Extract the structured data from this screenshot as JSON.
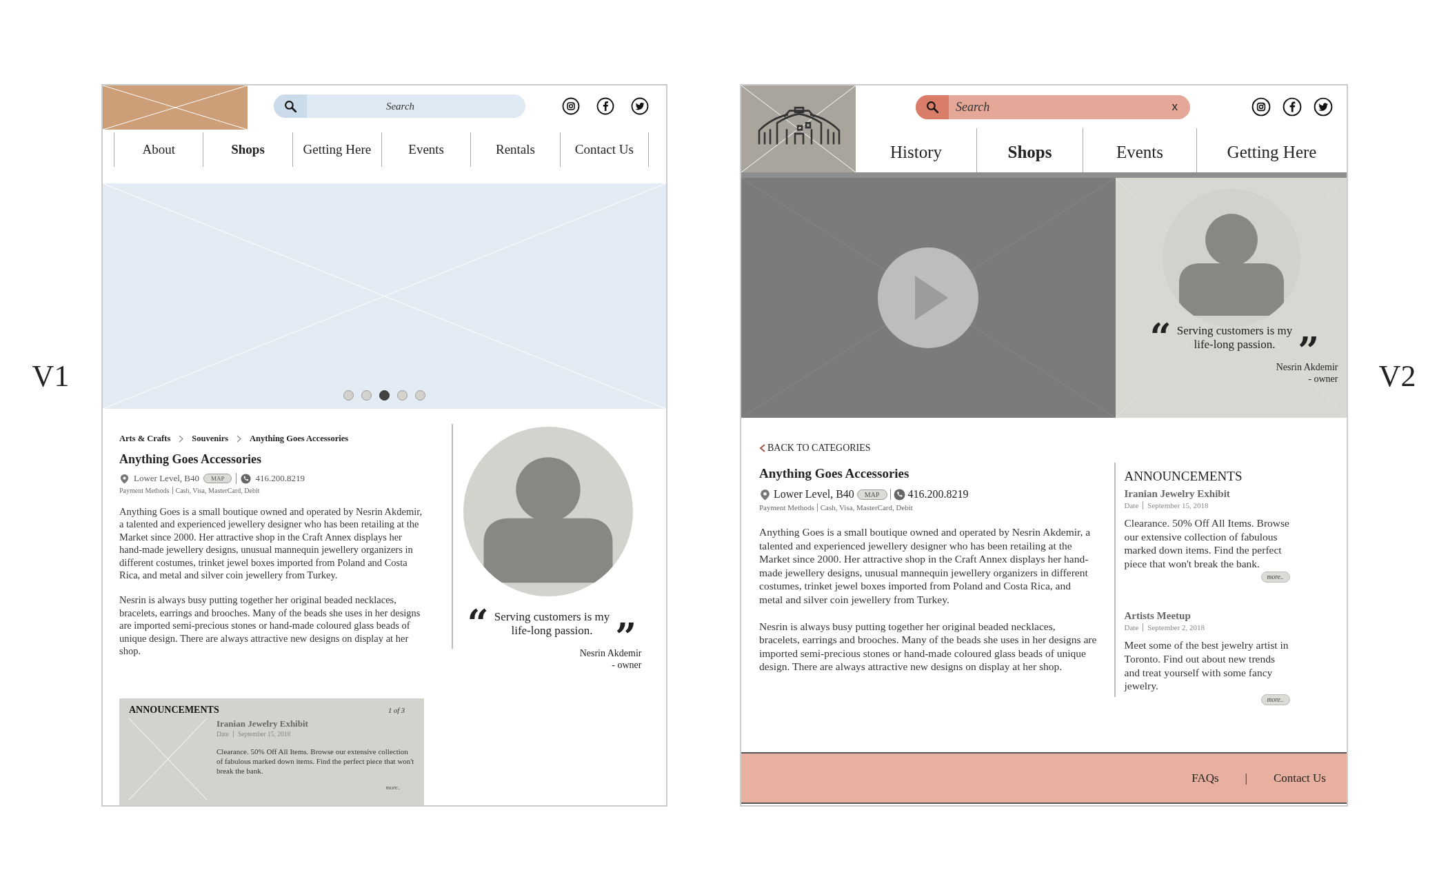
{
  "v1": {
    "label": "V1",
    "search": {
      "placeholder": "Search"
    },
    "nav": [
      {
        "label": "About",
        "selected": false
      },
      {
        "label": "Shops",
        "selected": true
      },
      {
        "label": "Getting Here",
        "selected": false
      },
      {
        "label": "Events",
        "selected": false
      },
      {
        "label": "Rentals",
        "selected": false
      },
      {
        "label": "Contact Us",
        "selected": false
      }
    ],
    "carousel": [
      {
        "selected": false
      },
      {
        "selected": false
      },
      {
        "selected": true
      },
      {
        "selected": false
      },
      {
        "selected": false
      }
    ],
    "breadcrumb": [
      "Arts & Crafts",
      "Souvenirs",
      "Anything Goes Accessories"
    ],
    "shop": {
      "name": "Anything Goes Accessories",
      "location": "Lower Level, B40",
      "map": "MAP",
      "phone": "416.200.8219",
      "payment_label": "Payment Methods",
      "payment": "Cash, Visa, MasterCard, Debit",
      "paragraphs": [
        "Anything Goes is a small boutique owned and operated by Nesrin Akdemir, a talented and experienced jewellery designer who has been retailing at the Market since 2000. Her attractive shop in the Craft Annex displays her hand-made jewellery designs, unusual mannequin jewellery organizers in different costumes, trinket jewel boxes imported from Poland and Costa Rica, and metal and silver coin jewellery from Turkey.",
        "Nesrin is always busy putting together her original beaded necklaces, bracelets, earrings and brooches. Many of the beads she uses in her designs are imported semi-precious stones or hand-made coloured glass beads of unique design. There are always attractive new designs on display at her shop."
      ]
    },
    "quote": {
      "open": "“",
      "lines": [
        "Serving customers is my",
        "life-long passion."
      ],
      "close": "”",
      "name": "Nesrin Akdemir",
      "role": "- owner"
    },
    "announcements": {
      "title": "ANNOUNCEMENTS",
      "pager": "1 of 3",
      "items": [
        {
          "title": "Iranian Jewelry Exhibit",
          "date_label": "Date",
          "date": "September 15, 2018",
          "text": "Clearance. 50% Off All Items. Browse our extensive collection of fabulous marked down items. Find the perfect piece that won't break the bank.",
          "more": "more.."
        }
      ]
    }
  },
  "v2": {
    "label": "V2",
    "search": {
      "placeholder": "Search",
      "clear": "x"
    },
    "nav": [
      {
        "label": "History",
        "selected": false
      },
      {
        "label": "Shops",
        "selected": true
      },
      {
        "label": "Events",
        "selected": false
      },
      {
        "label": "Getting Here",
        "selected": false
      }
    ],
    "quote": {
      "open": "“",
      "lines": [
        "Serving customers is my",
        "life-long passion."
      ],
      "close": "”",
      "name": "Nesrin Akdemir",
      "role": "- owner"
    },
    "back": "BACK TO CATEGORIES",
    "shop": {
      "name": "Anything Goes Accessories",
      "location": "Lower Level, B40",
      "map": "MAP",
      "phone": "416.200.8219",
      "payment_label": "Payment Methods",
      "payment": "Cash, Visa, MasterCard, Debit",
      "paragraphs": [
        "Anything Goes is a small boutique owned and operated by Nesrin Akdemir, a talented and experienced jewellery designer who has been retailing at the Market since 2000. Her attractive shop in the Craft Annex displays her hand-made jewellery designs, unusual mannequin jewellery organizers in different costumes, trinket jewel boxes imported from Poland and Costa Rica, and metal and silver coin jewellery from Turkey.",
        "Nesrin is always busy putting together her original beaded necklaces, bracelets, earrings and brooches. Many of the beads she uses in her designs are imported semi-precious stones or hand-made coloured glass beads of unique design. There are always attractive new designs on display at her shop."
      ]
    },
    "announcements": {
      "title": "ANNOUNCEMENTS",
      "items": [
        {
          "title": "Iranian Jewelry Exhibit",
          "date_label": "Date",
          "date": "September 15, 2018",
          "text": "Clearance. 50% Off All Items. Browse our extensive collection of fabulous marked down items. Find the perfect piece that won't break the bank.",
          "more": "more.."
        },
        {
          "title": "Artists Meetup",
          "date_label": "Date",
          "date": "September 2, 2018",
          "text": "Meet some of the best jewelry artist in Toronto. Find out about new trends and treat yourself with some fancy jewelry.",
          "more": "more.."
        }
      ]
    },
    "footer": {
      "links": [
        "FAQs",
        "Contact Us"
      ],
      "separator": "|"
    }
  }
}
